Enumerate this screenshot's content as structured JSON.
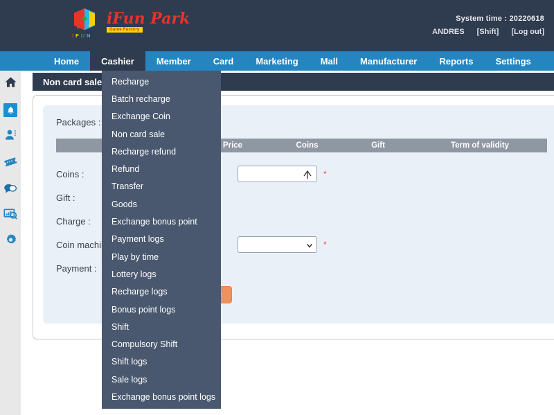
{
  "header": {
    "logo_title": "iFun Park",
    "logo_subtitle": "Game Factory",
    "logo_mark_label": "I F U N",
    "system_time_label": "System time : 20220618",
    "user_name": "ANDRES",
    "shift_link": "[Shift]",
    "logout_link": "[Log out]"
  },
  "nav": {
    "items": [
      {
        "label": "Home",
        "active": false
      },
      {
        "label": "Cashier",
        "active": true
      },
      {
        "label": "Member",
        "active": false
      },
      {
        "label": "Card",
        "active": false
      },
      {
        "label": "Marketing",
        "active": false
      },
      {
        "label": "Mall",
        "active": false
      },
      {
        "label": "Manufacturer",
        "active": false
      },
      {
        "label": "Reports",
        "active": false
      },
      {
        "label": "Settings",
        "active": false
      }
    ]
  },
  "rail": {
    "items": [
      {
        "icon": "home-icon",
        "selected": false
      },
      {
        "icon": "bell-icon",
        "selected": true
      },
      {
        "icon": "user-icon",
        "selected": false
      },
      {
        "icon": "ticket-icon",
        "selected": false
      },
      {
        "icon": "chat-icon",
        "selected": false
      },
      {
        "icon": "report-monitor-icon",
        "selected": false
      },
      {
        "icon": "gear-icon",
        "selected": false
      }
    ]
  },
  "dropdown": {
    "owner": "Cashier",
    "items": [
      "Recharge",
      "Batch recharge",
      "Exchange Coin",
      "Non card sale",
      "Recharge refund",
      "Refund",
      "Transfer",
      "Goods",
      "Exchange bonus point",
      "Payment logs",
      "Play by time",
      "Lottery logs",
      "Recharge logs",
      "Bonus point logs",
      "Shift",
      "Compulsory Shift",
      "Shift logs",
      "Sale logs",
      "Exchange bonus point logs"
    ]
  },
  "page": {
    "title": "Non card sale",
    "packages_label": "Packages :",
    "table_headers": {
      "name": "",
      "price": "Price",
      "coins": "Coins",
      "gift": "Gift",
      "term": "Term of validity"
    },
    "table_rows": [],
    "fields": [
      {
        "label": "Coins :",
        "type": "number",
        "value": "",
        "required": true
      },
      {
        "label": "Gift :",
        "type": "text",
        "value": "",
        "required": false
      },
      {
        "label": "Charge :",
        "type": "text",
        "value": "",
        "required": false
      },
      {
        "label": "Coin machine :",
        "type": "select",
        "value": "",
        "required": true
      },
      {
        "label": "Payment :",
        "type": "text",
        "value": "",
        "required": false
      }
    ],
    "submit_label": "Recharge"
  },
  "colors": {
    "header_bg": "#2f3b4e",
    "nav_bg": "#2585c0",
    "nav_active_bg": "#2f3b4e",
    "dropdown_bg": "#4a586f",
    "rail_bg": "#e8e8e8",
    "panel_inner_bg": "#eaf0f7",
    "table_header_bg": "#8f97a3",
    "accent_button": "#f0905a",
    "required_star": "#e8473f",
    "logo_red": "#e8342a",
    "logo_yellow": "#ffd400",
    "icon_blue": "#1a8fd1"
  }
}
